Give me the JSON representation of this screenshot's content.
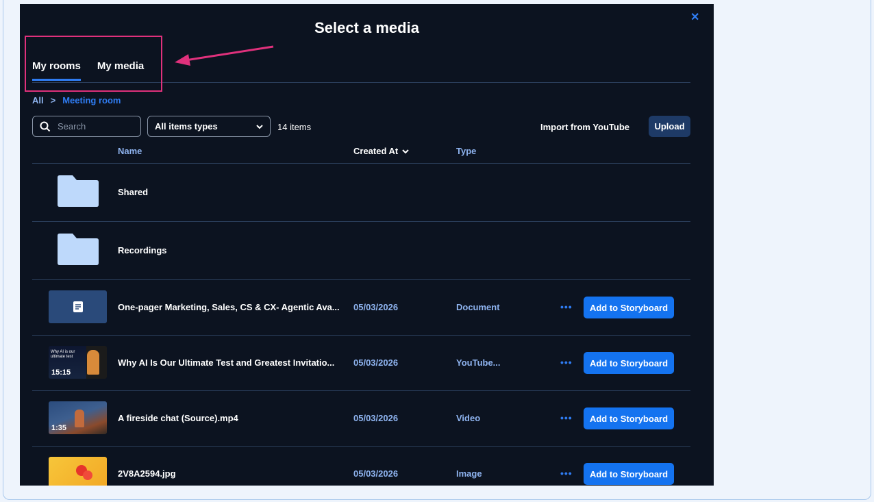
{
  "modal": {
    "title": "Select a media",
    "close_icon": "close-icon"
  },
  "tabs": [
    {
      "label": "My rooms",
      "active": true
    },
    {
      "label": "My media",
      "active": false
    }
  ],
  "breadcrumb": {
    "root": "All",
    "separator": ">",
    "current": "Meeting room"
  },
  "toolbar": {
    "search_placeholder": "Search",
    "filter_value": "All items types",
    "item_count": "14 items",
    "import_label": "Import from YouTube",
    "upload_label": "Upload"
  },
  "columns": {
    "name": "Name",
    "created_at": "Created At",
    "type": "Type"
  },
  "folders": [
    {
      "name": "Shared"
    },
    {
      "name": "Recordings"
    }
  ],
  "items": [
    {
      "name": "One-pager Marketing, Sales, CS & CX- Agentic Ava...",
      "date": "05/03/2026",
      "type": "Document",
      "thumb": "document-icon",
      "action": "Add to Storyboard",
      "more": "•••"
    },
    {
      "name": "Why AI Is Our Ultimate Test and Greatest Invitatio...",
      "date": "05/03/2026",
      "type": "YouTube...",
      "thumb": "video-thumbnail",
      "duration": "15:15",
      "thumb_text": "Why AI is our ultimate test",
      "action": "Add to Storyboard",
      "more": "•••"
    },
    {
      "name": "A fireside chat (Source).mp4",
      "date": "05/03/2026",
      "type": "Video",
      "thumb": "video-thumbnail",
      "duration": "1:35",
      "action": "Add to Storyboard",
      "more": "•••"
    },
    {
      "name": "2V8A2594.jpg",
      "date": "05/03/2026",
      "type": "Image",
      "thumb": "image-thumbnail",
      "action": "Add to Storyboard",
      "more": "•••"
    }
  ],
  "colors": {
    "modal_bg": "#0c1320",
    "accent": "#1473f0",
    "link": "#8fb4f0",
    "annotation": "#e0317c"
  }
}
